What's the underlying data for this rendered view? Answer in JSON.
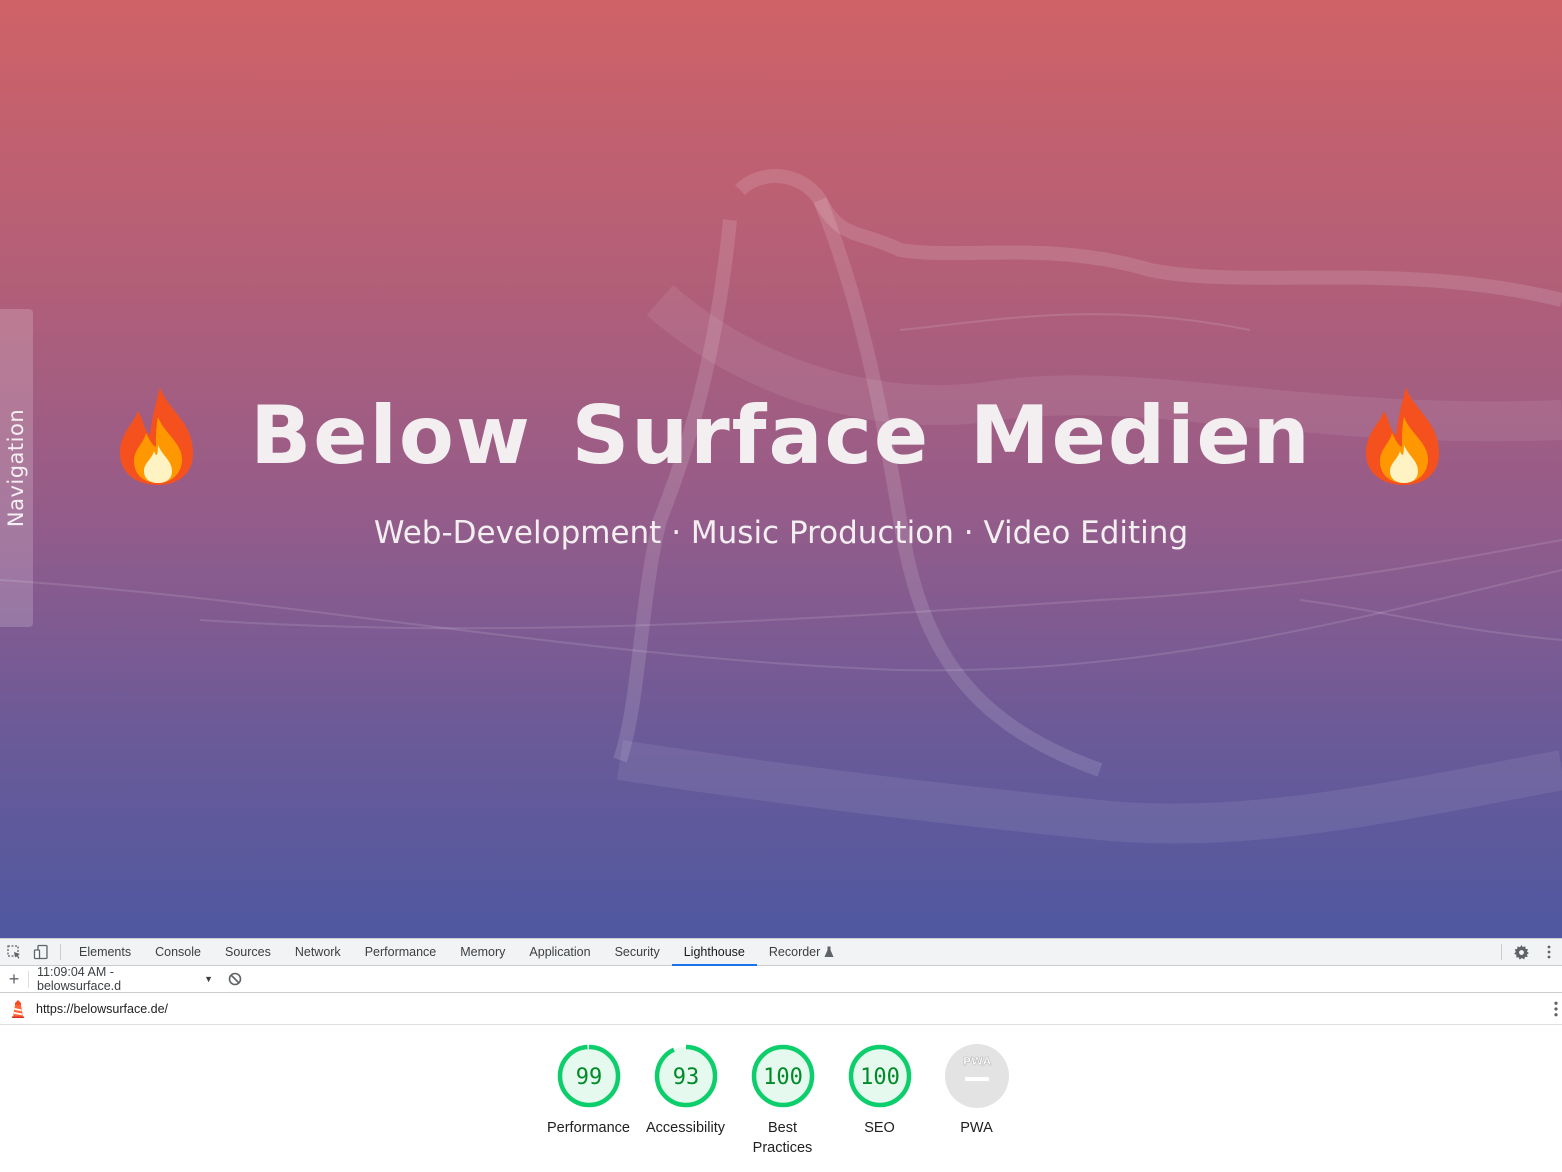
{
  "hero": {
    "title": "Below Surface Medien",
    "subtitle": "Web-Development · Music Production · Video Editing",
    "nav_label": "Navigation",
    "flame_icon": "fire-emoji"
  },
  "devtools": {
    "tabs": [
      "Elements",
      "Console",
      "Sources",
      "Network",
      "Performance",
      "Memory",
      "Application",
      "Security",
      "Lighthouse",
      "Recorder"
    ],
    "active_tab": "Lighthouse",
    "report_time": "11:09:04 AM - belowsurface.d",
    "url": "https://belowsurface.de/",
    "colors": {
      "pass": "#0cce6b",
      "pass_text": "#008a28",
      "tab_underline": "#1a73e8"
    }
  },
  "scores": [
    {
      "label": "Performance",
      "value": "99",
      "fraction": 0.99
    },
    {
      "label": "Accessibility",
      "value": "93",
      "fraction": 0.93
    },
    {
      "label": "Best Practices",
      "value": "100",
      "fraction": 1.0
    },
    {
      "label": "SEO",
      "value": "100",
      "fraction": 1.0
    },
    {
      "label": "PWA",
      "value": "",
      "badge": "PWA"
    }
  ]
}
